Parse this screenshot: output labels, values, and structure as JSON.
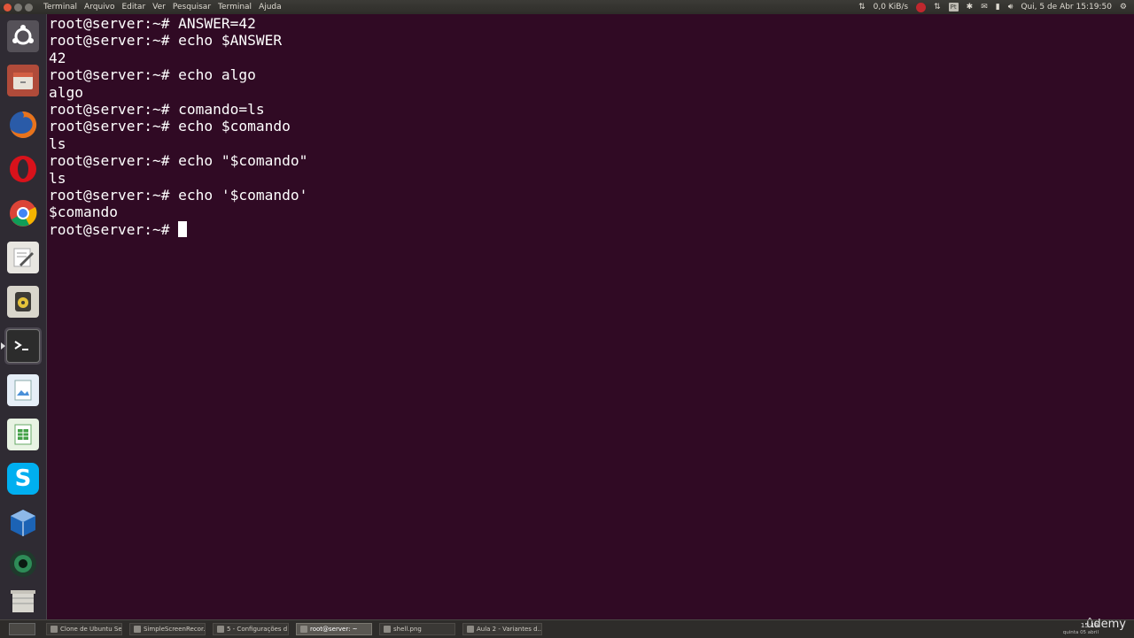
{
  "top_panel": {
    "menu": [
      "Terminal",
      "Arquivo",
      "Editar",
      "Ver",
      "Pesquisar",
      "Terminal",
      "Ajuda"
    ],
    "network_speed": "0,0 KiB/s",
    "keyboard": "Pt",
    "datetime": "Qui, 5 de Abr 15:19:50"
  },
  "launcher": {
    "items": [
      "ubuntu-dash-icon",
      "files-icon",
      "firefox-icon",
      "opera-icon",
      "chrome-icon",
      "text-editor-icon",
      "rhythmbox-icon",
      "terminal-icon",
      "image-viewer-icon",
      "spreadsheet-icon",
      "skype-icon",
      "virtualbox-icon",
      "camera-icon",
      "trash-icon"
    ]
  },
  "terminal": {
    "lines": [
      "root@server:~# ANSWER=42",
      "root@server:~# echo $ANSWER",
      "42",
      "root@server:~# echo algo",
      "algo",
      "root@server:~# comando=ls",
      "root@server:~# echo $comando",
      "ls",
      "root@server:~# echo \"$comando\"",
      "ls",
      "root@server:~# echo '$comando'",
      "$comando"
    ],
    "prompt": "root@server:~# "
  },
  "taskbar": {
    "tasks": [
      "Clone de Ubuntu Se...",
      "SimpleScreenRecor...",
      "5 - Configurações d...",
      "root@server: ~",
      "shell.png",
      "Aula 2 - Variantes d..."
    ],
    "active_index": 3,
    "clock_time": "15:19",
    "clock_date": "quinta 05 abril",
    "watermark": "ûdemy"
  },
  "colors": {
    "terminal_bg": "#300a24",
    "terminal_fg": "#ffffff",
    "panel_bg": "#3c3b37"
  }
}
